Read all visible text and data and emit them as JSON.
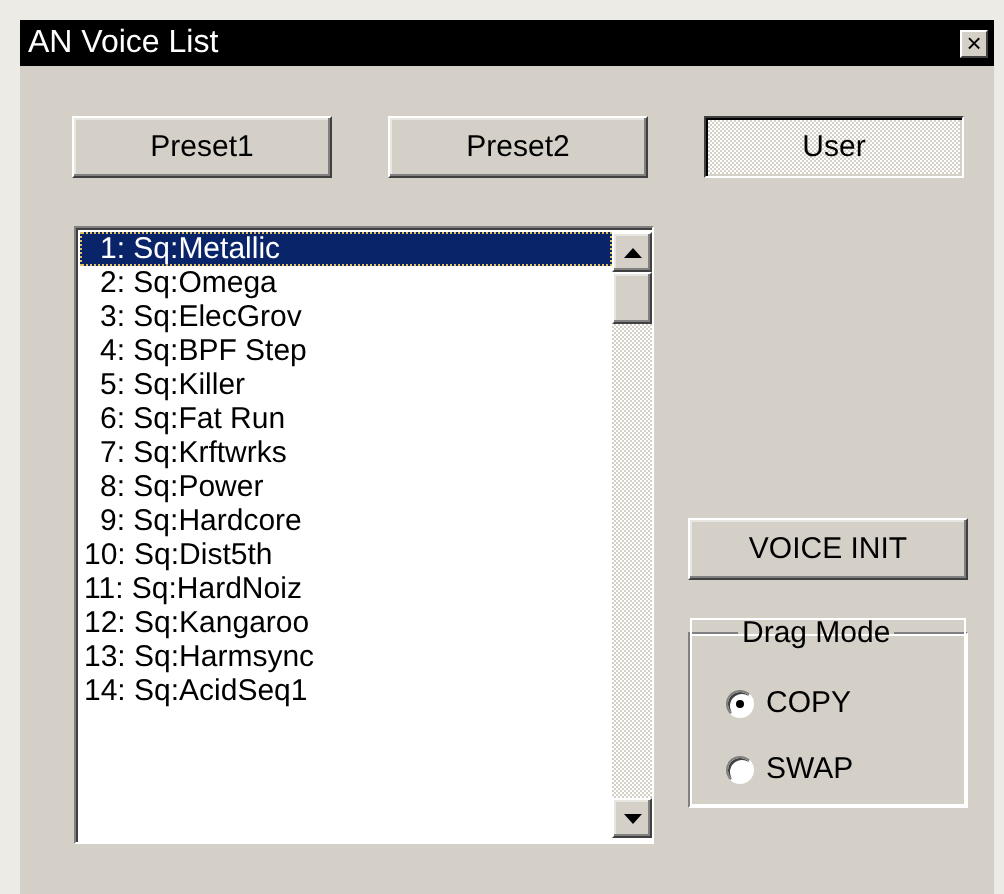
{
  "window": {
    "title": "AN Voice List",
    "close_glyph": "×"
  },
  "banks": [
    {
      "label": "Preset1",
      "selected": false
    },
    {
      "label": "Preset2",
      "selected": false
    },
    {
      "label": "User",
      "selected": true
    }
  ],
  "voices": [
    {
      "label": "1: Sq:Metallic",
      "selected": true
    },
    {
      "label": "2: Sq:Omega",
      "selected": false
    },
    {
      "label": "3: Sq:ElecGrov",
      "selected": false
    },
    {
      "label": "4: Sq:BPF Step",
      "selected": false
    },
    {
      "label": "5: Sq:Killer",
      "selected": false
    },
    {
      "label": "6: Sq:Fat Run",
      "selected": false
    },
    {
      "label": "7: Sq:Krftwrks",
      "selected": false
    },
    {
      "label": "8: Sq:Power",
      "selected": false
    },
    {
      "label": "9: Sq:Hardcore",
      "selected": false
    },
    {
      "label": "10: Sq:Dist5th",
      "selected": false
    },
    {
      "label": "11: Sq:HardNoiz",
      "selected": false
    },
    {
      "label": "12: Sq:Kangaroo",
      "selected": false
    },
    {
      "label": "13: Sq:Harmsync",
      "selected": false
    },
    {
      "label": "14: Sq:AcidSeq1",
      "selected": false
    }
  ],
  "voice_init_button": "VOICE INIT",
  "drag_mode": {
    "title": "Drag Mode",
    "options": [
      {
        "label": "COPY",
        "checked": true
      },
      {
        "label": "SWAP",
        "checked": false
      }
    ]
  }
}
